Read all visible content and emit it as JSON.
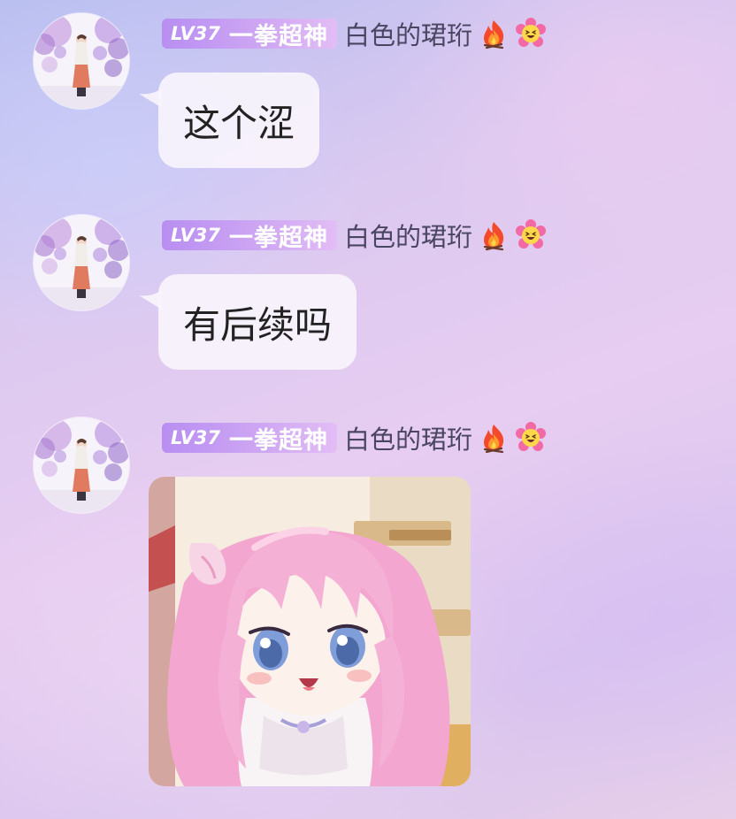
{
  "messages": [
    {
      "sender": {
        "level": "LV37",
        "badge_title": "一拳超神",
        "name": "白色的珺珩",
        "icons": [
          "fire-icon",
          "flower-grin-icon"
        ]
      },
      "type": "text",
      "text": "这个涩"
    },
    {
      "sender": {
        "level": "LV37",
        "badge_title": "一拳超神",
        "name": "白色的珺珩",
        "icons": [
          "fire-icon",
          "flower-grin-icon"
        ]
      },
      "type": "text",
      "text": "有后续吗"
    },
    {
      "sender": {
        "level": "LV37",
        "badge_title": "一拳超神",
        "name": "白色的珺珩",
        "icons": [
          "fire-icon",
          "flower-grin-icon"
        ]
      },
      "type": "sticker",
      "sticker": "pink-haired-chibi-girl-sticker"
    }
  ],
  "colors": {
    "badge_gradient_start": "#b88ef1",
    "badge_gradient_end": "#e3bdf5",
    "bubble_bg": "#f8f4fc",
    "username": "#4a4560"
  }
}
